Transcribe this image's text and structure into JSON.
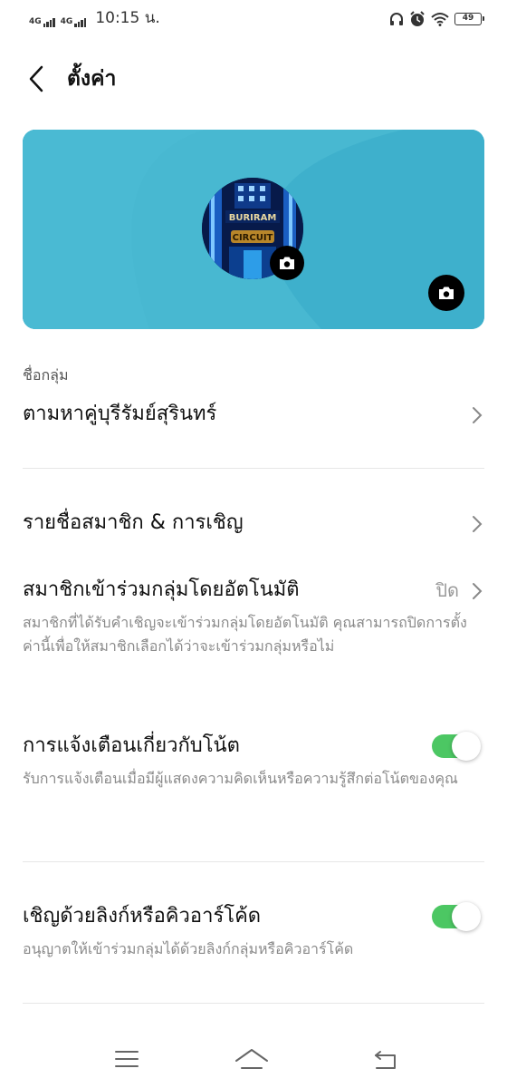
{
  "status_bar": {
    "signal1_label": "4G",
    "signal2_label": "4G",
    "time": "10:15 น.",
    "battery_level": "49"
  },
  "header": {
    "title": "ตั้งค่า"
  },
  "cover": {
    "avatar_text_top": "BURIRAM",
    "avatar_text_bottom": "CIRCUIT"
  },
  "settings": {
    "group_name_label": "ชื่อกลุ่ม",
    "group_name_value": "ตามหาคู่บุรีรัมย์สุรินทร์",
    "members_label": "รายชื่อสมาชิก & การเชิญ",
    "auto_join": {
      "title": "สมาชิกเข้าร่วมกลุ่มโดยอัตโนมัติ",
      "value": "ปิด",
      "description": "สมาชิกที่ได้รับคำเชิญจะเข้าร่วมกลุ่มโดยอัตโนมัติ คุณสามารถปิดการตั้งค่านี้เพื่อให้สมาชิกเลือกได้ว่าจะเข้าร่วมกลุ่มหรือไม่"
    },
    "note_notifications": {
      "title": "การแจ้งเตือนเกี่ยวกับโน้ต",
      "description": "รับการแจ้งเตือนเมื่อมีผู้แสดงความคิดเห็นหรือความรู้สึกต่อโน้ตของคุณ",
      "enabled": true
    },
    "invite_link": {
      "title": "เชิญด้วยลิงก์หรือคิวอาร์โค้ด",
      "description": "อนุญาตให้เข้าร่วมกลุ่มได้ด้วยลิงก์กลุ่มหรือคิวอาร์โค้ด",
      "enabled": true
    }
  },
  "colors": {
    "cover_bg": "#3eb0cc",
    "toggle_on": "#4cc763",
    "text_primary": "#111111",
    "text_secondary": "#8a8a8a"
  }
}
